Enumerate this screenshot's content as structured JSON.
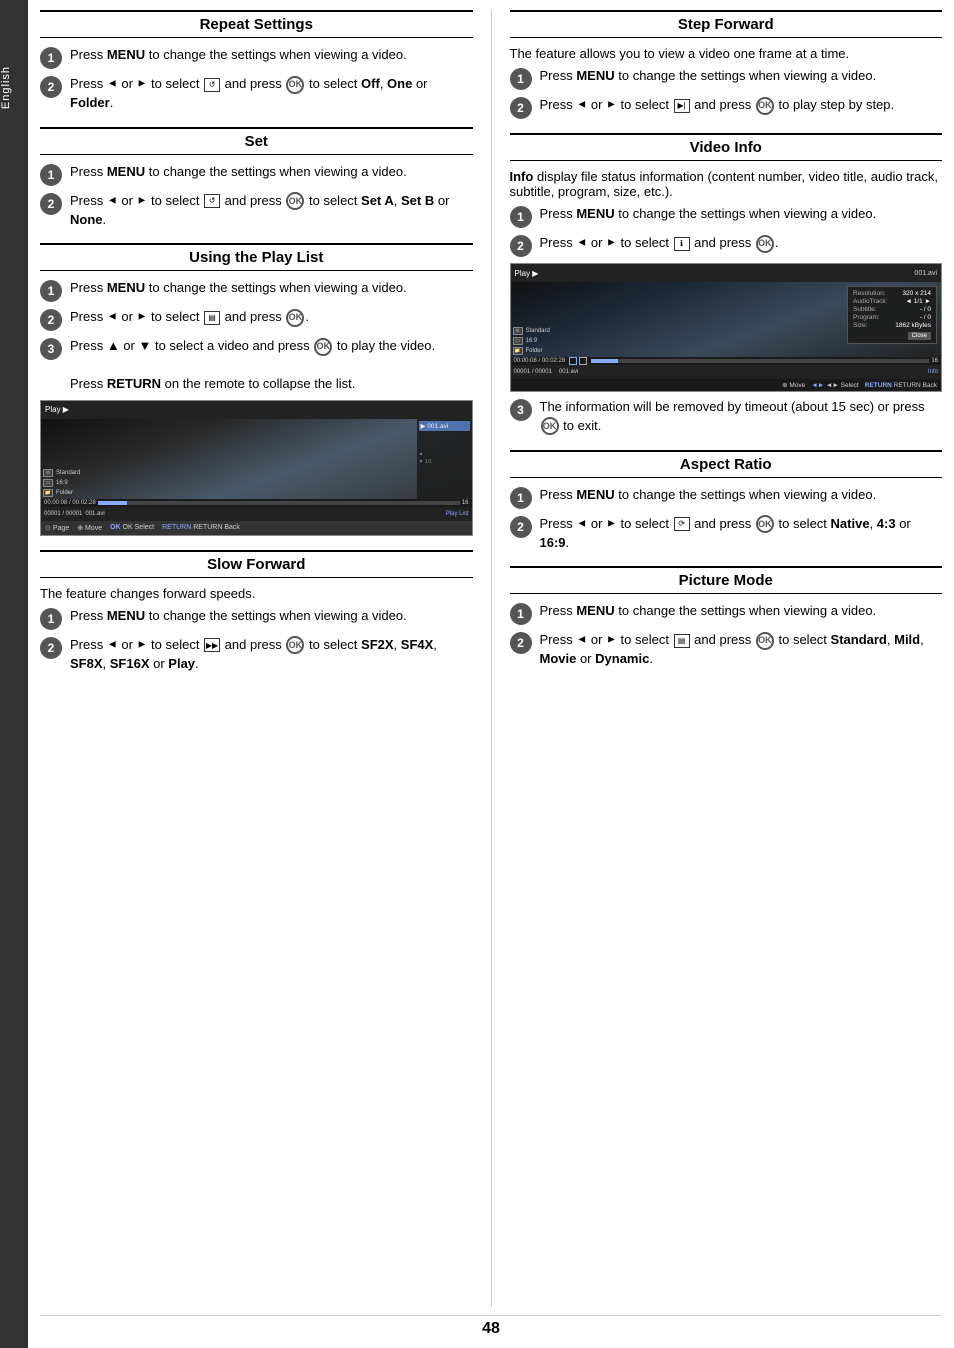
{
  "sidebar": {
    "label": "English"
  },
  "page_number": "48",
  "left_col": {
    "sections": [
      {
        "id": "repeat-settings",
        "title": "Repeat Settings",
        "steps": [
          {
            "num": "1",
            "text": "Press <b>MENU</b> to change the settings when viewing a video."
          },
          {
            "num": "2",
            "text": "Press ◄ or ► to select [icon:repeat] and press [OK] to select <b>Off</b>, <b>One</b> or <b>Folder</b>."
          }
        ]
      },
      {
        "id": "set",
        "title": "Set",
        "steps": [
          {
            "num": "1",
            "text": "Press <b>MENU</b> to change the settings when viewing a video."
          },
          {
            "num": "2",
            "text": "Press ◄ or ► to select [icon:set] and press [OK] to select <b>Set A</b>, <b>Set B</b> or <b>None</b>."
          }
        ]
      },
      {
        "id": "using-play-list",
        "title": "Using the Play List",
        "steps": [
          {
            "num": "1",
            "text": "Press <b>MENU</b> to change the settings when viewing a video."
          },
          {
            "num": "2",
            "text": "Press ◄ or ► to select [icon:playlist] and press [OK]."
          },
          {
            "num": "3",
            "text": "Press ▲ or ▼ to select a video and press [OK] to play the video.\n\nPress <b>RETURN</b> on the remote to collapse the list."
          }
        ]
      },
      {
        "id": "slow-forward",
        "title": "Slow Forward",
        "description": "The feature changes forward speeds.",
        "steps": [
          {
            "num": "1",
            "text": "Press <b>MENU</b> to change the settings when viewing a video."
          },
          {
            "num": "2",
            "text": "Press ◄ or ► to select [icon:slow] and press [OK] to select <b>SF2X</b>, <b>SF4X</b>, <b>SF8X</b>, <b>SF16X</b> or <b>Play</b>."
          }
        ]
      }
    ]
  },
  "right_col": {
    "sections": [
      {
        "id": "step-forward",
        "title": "Step Forward",
        "description": "The feature allows you to view a video one frame at a time.",
        "steps": [
          {
            "num": "1",
            "text": "Press <b>MENU</b> to change the settings when viewing a video."
          },
          {
            "num": "2",
            "text": "Press ◄ or ► to select [icon:step] and press [OK] to play step by step."
          }
        ]
      },
      {
        "id": "video-info",
        "title": "Video Info",
        "description": "<b>Info</b> display file status information (content number, video title, audio track, subtitle, program, size, etc.).",
        "steps": [
          {
            "num": "1",
            "text": "Press <b>MENU</b> to change the settings when viewing a video."
          },
          {
            "num": "2",
            "text": "Press ◄ or ► to select [icon:info] and press [OK]."
          },
          {
            "num": "3",
            "text": "The information will be removed by timeout (about 15 sec) or press [OK] to exit."
          }
        ]
      },
      {
        "id": "aspect-ratio",
        "title": "Aspect Ratio",
        "steps": [
          {
            "num": "1",
            "text": "Press <b>MENU</b> to change the settings when viewing a video."
          },
          {
            "num": "2",
            "text": "Press ◄ or ► to select [icon:aspect] and press [OK] to select <b>Native</b>, <b>4:3</b> or <b>16:9</b>."
          }
        ]
      },
      {
        "id": "picture-mode",
        "title": "Picture Mode",
        "steps": [
          {
            "num": "1",
            "text": "Press <b>MENU</b> to change the settings when viewing a video."
          },
          {
            "num": "2",
            "text": "Press ◄ or ► to select [icon:picture] and press [OK] to select <b>Standard</b>, <b>Mild</b>, <b>Movie</b> or <b>Dynamic</b>."
          }
        ]
      }
    ]
  },
  "playlist_screen": {
    "title": "Play ▶",
    "filename": "001.avi",
    "counter": "00001 / 00001",
    "time": "00:00:08 / 00:02:28",
    "page_label": "Page",
    "move_label": "Move",
    "ok_label": "OK Select",
    "return_label": "RETURN Back",
    "playlist_label": "Play List",
    "number_right": "16",
    "icon1": "Standard",
    "icon2": "16:9",
    "icon3": "Folder"
  },
  "vinfo_screen": {
    "title": "Play ▶",
    "filename": "001.avi",
    "counter": "00001 / 00001",
    "filename2": "001.avi",
    "time": "00:00:08 / 00:02:28",
    "number_right": "16",
    "info_label": "Info",
    "move_label": "Move",
    "select_label": "◄► Select",
    "return_label": "RETURN Back",
    "resolution_label": "Resolution:",
    "resolution_value": "320 x 214",
    "audio_label": "AudioTrack:",
    "audio_value": "◄ 1/1 ►",
    "subtitle_label": "Subtitle:",
    "subtitle_value": "- / 0",
    "program_label": "Program:",
    "program_value": "- / 0",
    "size_label": "Size:",
    "size_value": "1862 kBytes",
    "close_label": "Close",
    "icon1": "Standard",
    "icon2": "16:9",
    "icon3": "Folder"
  }
}
